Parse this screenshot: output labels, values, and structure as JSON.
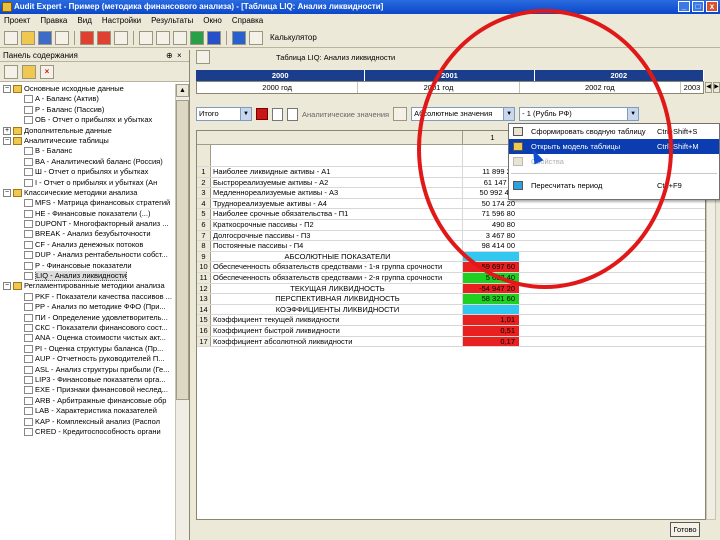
{
  "window": {
    "title": "Audit Expert - Пример (методика финансового анализа) - [Таблица LIQ: Анализ ликвидности]",
    "min": "_",
    "max": "□",
    "close": "x"
  },
  "menubar": [
    "Проект",
    "Правка",
    "Вид",
    "Настройки",
    "Результаты",
    "Окно",
    "Справка"
  ],
  "toolbar": {
    "calculator_label": "Калькулятор"
  },
  "leftpanel": {
    "title": "Панель содержания",
    "items": [
      {
        "label": "Основные исходные данные",
        "level": 0,
        "exp": "−"
      },
      {
        "label": "A - Баланс (Актив)",
        "level": 1
      },
      {
        "label": "P - Баланс (Пассив)",
        "level": 1
      },
      {
        "label": "ОБ - Отчет о прибылях и убытках",
        "level": 1
      },
      {
        "label": "Дополнительные данные",
        "level": 0,
        "exp": "+"
      },
      {
        "label": "Аналитические таблицы",
        "level": 0,
        "exp": "−"
      },
      {
        "label": "B - Баланс",
        "level": 1
      },
      {
        "label": "BA - Аналитический баланс (Россия)",
        "level": 1
      },
      {
        "label": "Ш - Отчет о прибылях и убытках",
        "level": 1
      },
      {
        "label": "I - Отчет о прибылях и убытках (Ан",
        "level": 1
      },
      {
        "label": "Классические методики анализа",
        "level": 0,
        "exp": "−"
      },
      {
        "label": "MFS - Матрица финансовых стратегий",
        "level": 1
      },
      {
        "label": "НЕ - Финансовые показатели (...)",
        "level": 1
      },
      {
        "label": "DUPONT - Многофакторный анализ ...",
        "level": 1
      },
      {
        "label": "BREAK - Анализ безубыточности",
        "level": 1
      },
      {
        "label": "CF - Анализ денежных потоков",
        "level": 1
      },
      {
        "label": "DUP - Анализ рентабельности собст...",
        "level": 1
      },
      {
        "label": "P - Финансовые показатели",
        "level": 1
      },
      {
        "label": "LIQ - Анализ ликвидности",
        "level": 1,
        "selected": true
      },
      {
        "label": "Регламентированные методики анализа",
        "level": 0,
        "exp": "−"
      },
      {
        "label": "PKF - Показатели качества пассивов ...",
        "level": 1
      },
      {
        "label": "PP - Анализ по методике ФФО (При...",
        "level": 1
      },
      {
        "label": "ПИ - Определение удовлетворитель...",
        "level": 1
      },
      {
        "label": "СКС - Показатели финансового сост...",
        "level": 1
      },
      {
        "label": "ANA - Оценка стоимости чистых акт...",
        "level": 1
      },
      {
        "label": "PI - Оценка структуры баланса (Пр...",
        "level": 1
      },
      {
        "label": "AUP - Отчетность руководителей П...",
        "level": 1
      },
      {
        "label": "ASL - Анализ структуры прибыли (Ге...",
        "level": 1
      },
      {
        "label": "LIP3 - Финансовые показатели орга...",
        "level": 1
      },
      {
        "label": "EXE - Признаки финансовой неслед...",
        "level": 1
      },
      {
        "label": "ARB - Арбитражные финансовые обр",
        "level": 1
      },
      {
        "label": "LAB - Характеристика показателей",
        "level": 1
      },
      {
        "label": "KAP - Комплексный анализ (Распол",
        "level": 1
      },
      {
        "label": "CRED - Кредитоспособность органи",
        "level": 1
      }
    ]
  },
  "tabs": {
    "current": "Таблица LIQ: Анализ ликвидности"
  },
  "years": [
    {
      "year": "2000",
      "sub": "2000 год"
    },
    {
      "year": "2001",
      "sub": "2001 год"
    },
    {
      "year": "2002",
      "sub": "2002 год"
    }
  ],
  "year_sub_extra": "2003",
  "filters": {
    "period": "Итого",
    "view_label": "Аналитические значения",
    "mode": "Абсолютные значения",
    "currency": "- 1 (Рубль РФ)"
  },
  "grid": {
    "col_header": "1",
    "rows": [
      {
        "num": "1",
        "name": "Наиболее ликвидные активы - А1",
        "val": "11 899 20",
        "color": ""
      },
      {
        "num": "2",
        "name": "Быстрореализуемые активы - А2",
        "val": "61 147 ...",
        "color": ""
      },
      {
        "num": "3",
        "name": "Медленнореализуемые активы - А3",
        "val": "50 992 4...",
        "color": ""
      },
      {
        "num": "4",
        "name": "Труднореализуемые активы - А4",
        "val": "50 174 20",
        "color": ""
      },
      {
        "num": "5",
        "name": "Наиболее срочные обязательства - П1",
        "val": "71 596 80",
        "color": ""
      },
      {
        "num": "6",
        "name": "Краткосрочные пассивы - П2",
        "val": "490 80",
        "color": ""
      },
      {
        "num": "7",
        "name": "Долгосрочные пассивы - П3",
        "val": "3 467 80",
        "color": ""
      },
      {
        "num": "8",
        "name": "Постоянные пассивы - П4",
        "val": "98 414 00",
        "color": ""
      },
      {
        "num": "9",
        "name": "АБСОЛЮТНЫЕ ПОКАЗАТЕЛИ",
        "val": "",
        "color": "blue",
        "center": true
      },
      {
        "num": "10",
        "name": "Обеспеченность обязательств средствами - 1-я группа срочности",
        "val": "-59 697 60",
        "color": "red"
      },
      {
        "num": "11",
        "name": "Обеспеченность обязательств средствами - 2-я группа срочности",
        "val": "5 657 40",
        "color": "green"
      },
      {
        "num": "12",
        "name": "ТЕКУЩАЯ ЛИКВИДНОСТЬ",
        "val": "-54 947 20",
        "color": "red",
        "center": true
      },
      {
        "num": "13",
        "name": "ПЕРСПЕКТИВНАЯ ЛИКВИДНОСТЬ",
        "val": "58 321 60",
        "color": "green",
        "center": true
      },
      {
        "num": "14",
        "name": "КОЭФФИЦИЕНТЫ ЛИКВИДНОСТИ",
        "val": "",
        "color": "blue",
        "center": true
      },
      {
        "num": "15",
        "name": "Коэффициент текущей ликвидности",
        "val": "1,01",
        "color": "red"
      },
      {
        "num": "16",
        "name": "Коэффициент быстрой ликвидности",
        "val": "0,51",
        "color": "red"
      },
      {
        "num": "17",
        "name": "Коэффициент абсолютной ликвидности",
        "val": "0,17",
        "color": "red"
      }
    ]
  },
  "context_menu": {
    "items": [
      {
        "label": "Сформировать сводную таблицу",
        "shortcut": "Ctrl+Shift+S",
        "state": "normal"
      },
      {
        "label": "Открыть модель таблицы",
        "shortcut": "Ctrl+Shift+M",
        "state": "highlighted"
      },
      {
        "label": "Свойства",
        "shortcut": "",
        "state": "disabled"
      },
      {
        "label": "Пересчитать период",
        "shortcut": "Ctrl+F9",
        "state": "normal"
      }
    ]
  },
  "status": {
    "close_label": "Готово"
  },
  "colors": {
    "annotation": "#e01818",
    "header_blue": "#1a3d8c",
    "cell_blue": "#30c8f0",
    "cell_green": "#20d020",
    "cell_red": "#e82020"
  }
}
